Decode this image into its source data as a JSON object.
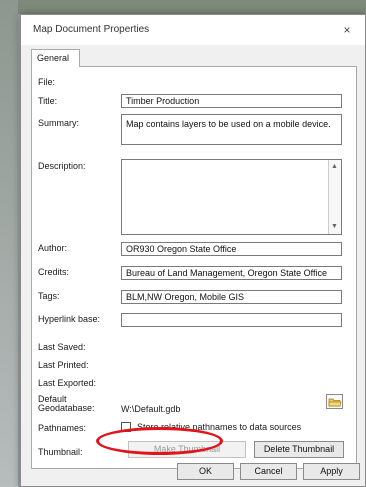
{
  "window": {
    "title": "Map Document Properties",
    "close_glyph": "×"
  },
  "tabs": [
    {
      "label": "General"
    }
  ],
  "fields": {
    "file": {
      "label": "File:",
      "value": ""
    },
    "title": {
      "label": "Title:",
      "value": "Timber Production"
    },
    "summary": {
      "label": "Summary:",
      "value": "Map contains layers to be used on a mobile device."
    },
    "description": {
      "label": "Description:",
      "value": ""
    },
    "author": {
      "label": "Author:",
      "value": "OR930 Oregon State Office"
    },
    "credits": {
      "label": "Credits:",
      "value": "Bureau of Land Management, Oregon State Office"
    },
    "tags": {
      "label": "Tags:",
      "value": "BLM,NW Oregon, Mobile GIS"
    },
    "hyperlink_base": {
      "label": "Hyperlink base:",
      "value": ""
    },
    "last_saved": {
      "label": "Last Saved:",
      "value": ""
    },
    "last_printed": {
      "label": "Last Printed:",
      "value": ""
    },
    "last_exported": {
      "label": "Last Exported:",
      "value": ""
    },
    "default_geodatabase": {
      "label_line1": "Default",
      "label_line2": "Geodatabase:",
      "value": "W:\\Default.gdb"
    },
    "pathnames": {
      "label": "Pathnames:",
      "checkbox_label": "Store relative pathnames to data sources",
      "checked": false
    },
    "thumbnail": {
      "label": "Thumbnail:"
    }
  },
  "buttons": {
    "make_thumbnail": "Make Thumbnail",
    "delete_thumbnail": "Delete Thumbnail",
    "ok": "OK",
    "cancel": "Cancel",
    "apply": "Apply"
  },
  "icons": {
    "close": "close-icon",
    "browse": "folder-icon"
  },
  "colors": {
    "highlight": "#e0141a",
    "folder": "#f2c94c"
  }
}
